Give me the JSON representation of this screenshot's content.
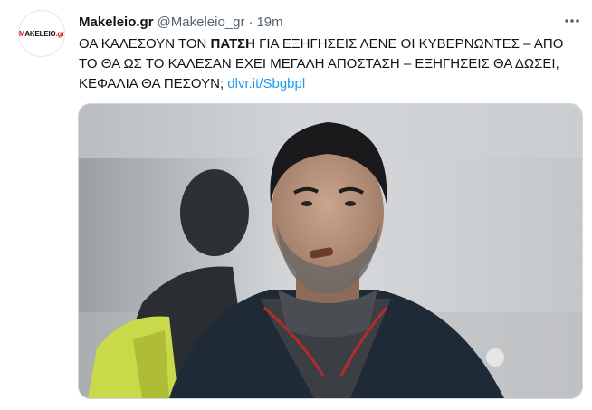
{
  "account": {
    "avatar_logo_left": "M",
    "avatar_logo_mid": "AKELEIO",
    "avatar_logo_right": ".gr",
    "name": "Makeleio.gr",
    "handle": "@Makeleio_gr",
    "separator": "·",
    "time": "19m"
  },
  "tweet": {
    "text_1": "ΘΑ ΚΑΛΕΣΟΥΝ ΤΟΝ ",
    "text_bold": "ΠΑΤΣΗ",
    "text_2": " ΓΙΑ ΕΞΗΓΗΣΕΙΣ ΛΕΝΕ ΟΙ ΚΥΒΕΡΝΩΝΤΕΣ – ΑΠΟ ΤΟ ΘΑ ΩΣ ΤΟ ΚΑΛΕΣΑΝ ΕΧΕΙ ΜΕΓΑΛΗ ΑΠΟΣΤΑΣΗ – ΕΞΗΓΗΣΕΙΣ ΘΑ ΔΩΣΕΙ, ΚΕΦΑΛΙΑ ΘΑ ΠΕΣΟΥΝ; ",
    "link": "dlvr.it/Sbgbpl"
  },
  "colors": {
    "link": "#1d9bf0",
    "muted": "#536471",
    "logo_red": "#d4141b"
  },
  "icons": {
    "more": "more-dots-icon",
    "photo": "photo-media"
  }
}
